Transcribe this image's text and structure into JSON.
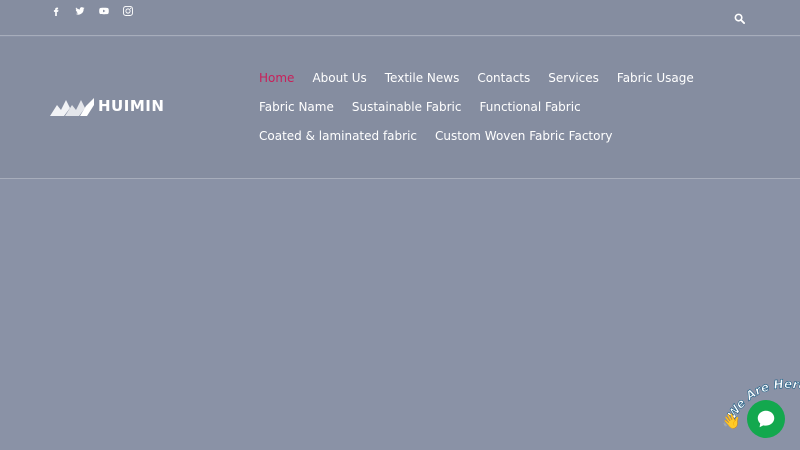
{
  "topbar": {
    "social": [
      {
        "name": "facebook-icon"
      },
      {
        "name": "twitter-icon"
      },
      {
        "name": "youtube-icon"
      },
      {
        "name": "instagram-icon"
      }
    ],
    "search_icon": "search-icon"
  },
  "header": {
    "logo_text": "HUIMIN",
    "nav": [
      {
        "label": "Home",
        "active": true
      },
      {
        "label": "About Us"
      },
      {
        "label": "Textile News"
      },
      {
        "label": "Contacts"
      },
      {
        "label": "Services"
      },
      {
        "label": "Fabric Usage"
      },
      {
        "label": "Fabric Name"
      },
      {
        "label": "Sustainable Fabric"
      },
      {
        "label": "Functional Fabric"
      },
      {
        "label": "Coated & laminated fabric"
      },
      {
        "label": "Custom Woven Fabric Factory"
      }
    ]
  },
  "chat": {
    "label": "We Are Here!",
    "bubble_color": "#13a84e"
  },
  "colors": {
    "accent": "#c8205a",
    "overlay": "#8a92a6"
  }
}
